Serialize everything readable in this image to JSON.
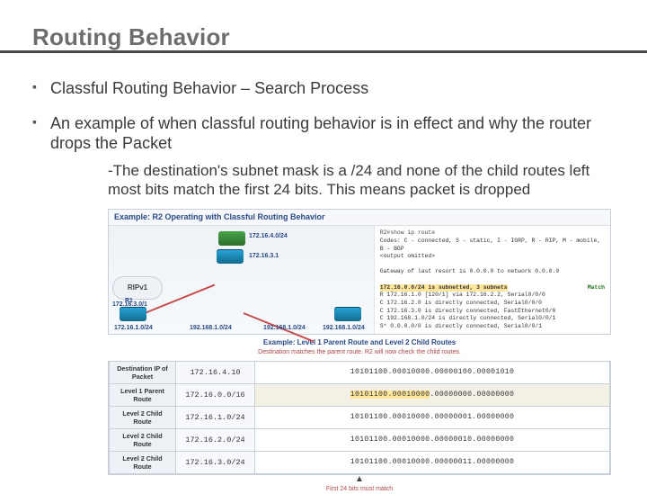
{
  "title": "Routing Behavior",
  "bullets": [
    "Classful Routing Behavior – Search Process",
    "An example of when classful routing behavior is in effect and why the router drops the Packet"
  ],
  "sub": "-The destination's subnet mask is a /24 and none of the child routes left most bits match the first 24 bits.  This means packet is dropped",
  "figure": {
    "top_caption": "Example: R2 Operating with Classful Routing Behavior",
    "mid_caption": "Example: Level 1 Parent Route and Level 2 Child Routes",
    "mid_hint": "Destination matches the parent route. R2 will now check the child routes."
  },
  "topology": {
    "sw_net": "172.16.4.0/24",
    "r2_ip": "172.16.3.1",
    "cloud": "RIPv1",
    "cloud_net": "172.16.3.0/1",
    "r1_net": "172.16.1.0/24",
    "r3_net": "192.168.1.0/24",
    "mid_left": "192.168.1.0/24",
    "mid_right": "192.168.1.0/24"
  },
  "tty": {
    "header": "R2#show ip route",
    "codes1": "Codes: C - connected, S - static, I - IGRP, R - RIP, M - mobile, B - BGP",
    "codes2": "      <output omitted>",
    "gw": "Gateway of last resort is 0.0.0.0 to network 0.0.0.0",
    "parent": "   172.16.0.0/24 is subnetted, 3 subnets",
    "match": "Match",
    "r1": "R     172.16.1.0 [120/1] via 172.16.2.2, Serial0/0/0",
    "r2": "C     172.16.2.0 is directly connected, Serial0/0/0",
    "r3": "C     172.16.3.0 is directly connected, FastEthernet0/0",
    "r4": "C  192.168.1.0/24 is directly connected, Serial0/0/1",
    "r5": "S* 0.0.0.0/0 is directly connected, Serial0/0/1"
  },
  "bits": {
    "rows": [
      {
        "h": "Destination IP of Packet",
        "addr": "172.16.4.10",
        "bin": "10101100.00010000.00000100.00001010"
      },
      {
        "h": "Level 1 Parent Route",
        "addr": "172.16.0.0/16",
        "binA": "10101100.00010000",
        "binB": ".00000000.00000000"
      },
      {
        "h": "Level 2 Child Route",
        "addr": "172.16.1.0/24",
        "bin": "10101100.00010000.00000001.00000000"
      },
      {
        "h": "Level 2 Child Route",
        "addr": "172.16.2.0/24",
        "bin": "10101100.00010000.00000010.00000000"
      },
      {
        "h": "Level 2 Child Route",
        "addr": "172.16.3.0/24",
        "bin": "10101100.00010000.00000011.00000000"
      }
    ],
    "footnote": "First 24 bits must match"
  }
}
